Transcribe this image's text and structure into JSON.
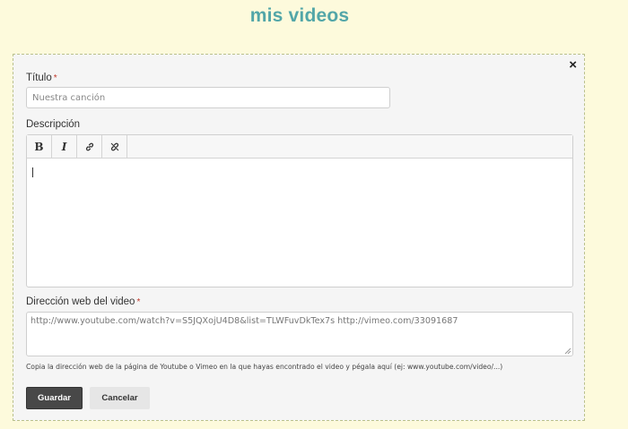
{
  "page": {
    "title": "mis videos"
  },
  "form": {
    "close_icon": "×",
    "title_label": "Título",
    "title_required_mark": "*",
    "title_placeholder": "Nuestra canción",
    "description_label": "Descripción",
    "toolbar": {
      "bold": "B",
      "italic": "I",
      "icons": [
        "bold-icon",
        "italic-icon",
        "link-icon",
        "unlink-icon"
      ]
    },
    "url_label": "Dirección web del video",
    "url_required_mark": "*",
    "url_placeholder": "http://www.youtube.com/watch?v=S5JQXojU4D8&list=TLWFuvDkTex7s http://vimeo.com/33091687",
    "help_text": "Copia la dirección web de la página de Youtube o Vimeo en la que hayas encontrado el video y pégala aquí (ej: www.youtube.com/video/...)",
    "save_label": "Guardar",
    "cancel_label": "Cancelar"
  },
  "colors": {
    "background": "#fdfadc",
    "title": "#52a6a8",
    "panel_border": "#b9c08c",
    "save_button": "#484848"
  }
}
